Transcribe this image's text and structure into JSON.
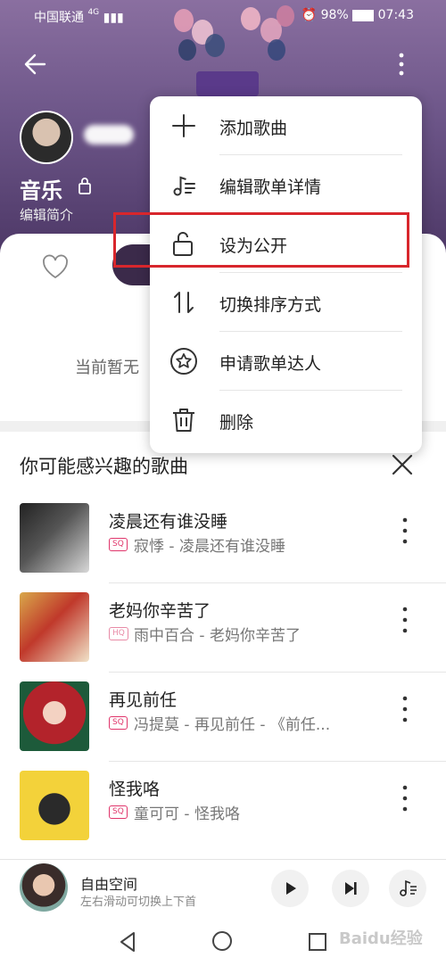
{
  "status": {
    "carrier": "中国联通",
    "network": "4G",
    "battery": "98%",
    "time": "07:43"
  },
  "playlist": {
    "title": "音乐",
    "edit_desc": "编辑简介",
    "empty_text": "当前暂无"
  },
  "menu": {
    "items": [
      {
        "label": "添加歌曲",
        "icon": "plus-icon"
      },
      {
        "label": "编辑歌单详情",
        "icon": "edit-list-icon"
      },
      {
        "label": "设为公开",
        "icon": "unlock-icon"
      },
      {
        "label": "切换排序方式",
        "icon": "sort-icon"
      },
      {
        "label": "申请歌单达人",
        "icon": "star-badge-icon"
      },
      {
        "label": "删除",
        "icon": "trash-icon"
      }
    ]
  },
  "recommend": {
    "title": "你可能感兴趣的歌曲",
    "songs": [
      {
        "title": "凌晨还有谁没睡",
        "quality": "SQ",
        "subtitle": "寂悸 - 凌晨还有谁没睡"
      },
      {
        "title": "老妈你辛苦了",
        "quality": "HQ",
        "subtitle": "雨中百合 - 老妈你辛苦了"
      },
      {
        "title": "再见前任",
        "quality": "SQ",
        "subtitle": "冯提莫 - 再见前任 - 《前任..."
      },
      {
        "title": "怪我咯",
        "quality": "SQ",
        "subtitle": "童可可 - 怪我咯"
      }
    ]
  },
  "player": {
    "title": "自由空间",
    "subtitle": "左右滑动可切换上下首"
  },
  "watermark": "Baidu经验",
  "colors": {
    "accent": "#d8262c",
    "sq_badge": "#e0356b",
    "hq_badge": "#e88aa6"
  }
}
